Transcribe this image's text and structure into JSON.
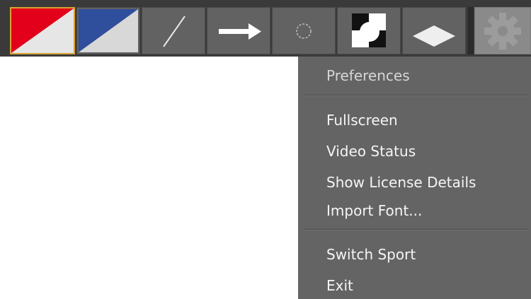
{
  "toolbar": {
    "tools": [
      {
        "name": "red-white-color-swatch",
        "selected": true,
        "color_primary": "#e3001b",
        "color_secondary": "#e6e6e6"
      },
      {
        "name": "blue-white-color-swatch",
        "selected": false,
        "color_primary": "#2f4e9c",
        "color_secondary": "#d8d8d8"
      },
      {
        "name": "line-tool-icon"
      },
      {
        "name": "arrow-tool-icon"
      },
      {
        "name": "circle-tool-icon"
      },
      {
        "name": "spotlight-tool-icon"
      },
      {
        "name": "diamond-tool-icon"
      },
      {
        "name": "gear-icon",
        "disabled": true
      }
    ],
    "colors": {
      "selected_border": "#d8a334",
      "button_bg": "#626262",
      "bar_bg": "#3a3a3a"
    }
  },
  "menu": {
    "title": "Preferences",
    "groups": [
      [
        "Fullscreen",
        "Video Status",
        "Show License Details",
        "Import Font..."
      ],
      [
        "Switch Sport",
        "Exit"
      ]
    ],
    "colors": {
      "background": "#646464",
      "text": "#f5f5f5"
    }
  }
}
